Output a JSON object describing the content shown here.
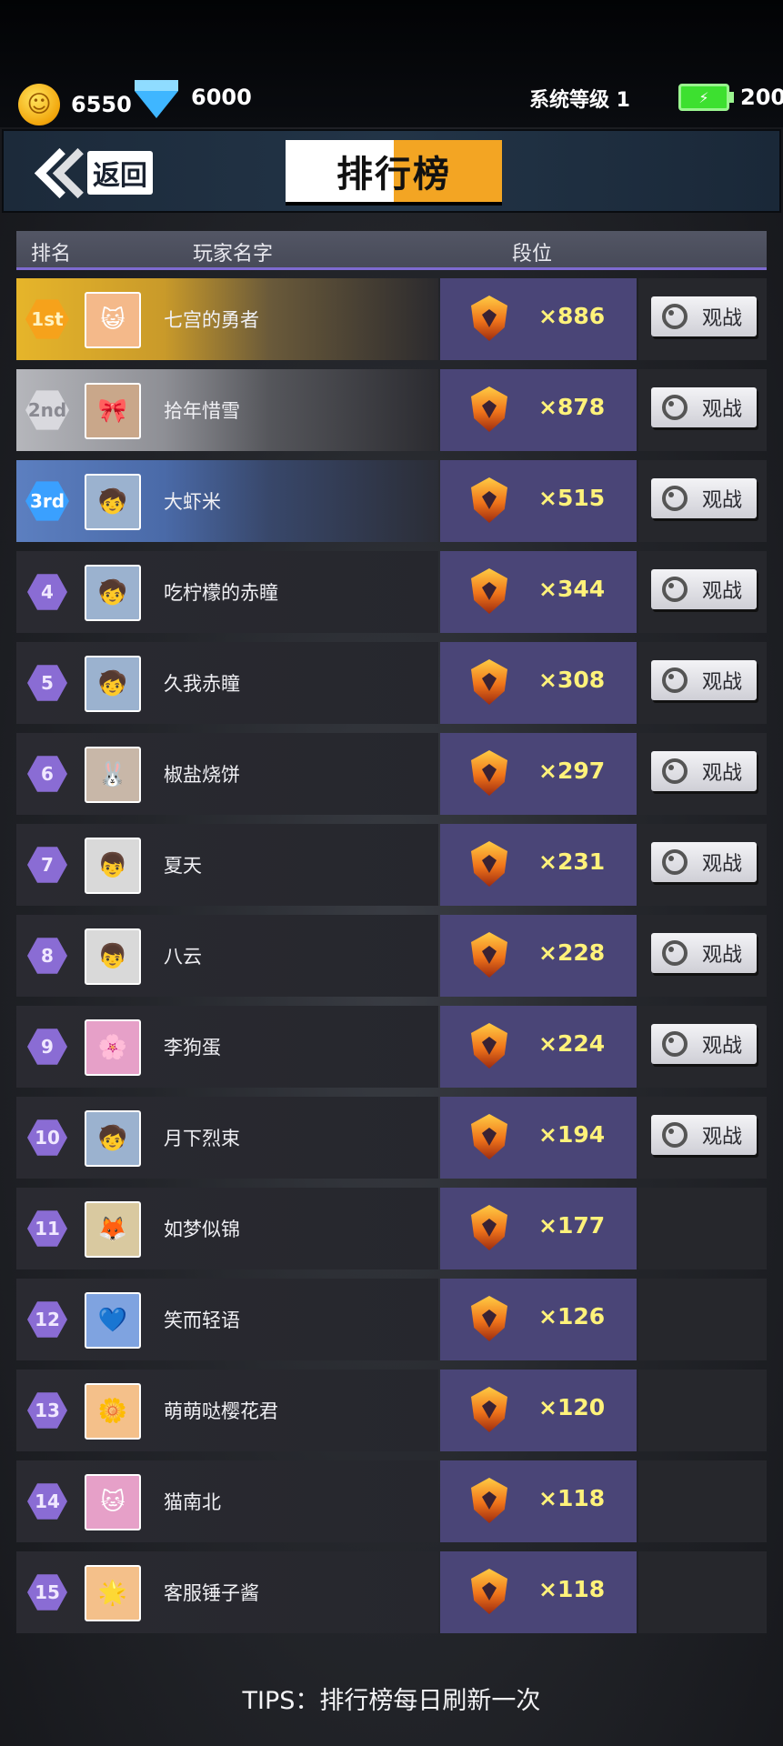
{
  "resources": {
    "coins": "6550",
    "gems": "6000",
    "system_level": "系统等级 1",
    "energy": "200"
  },
  "nav": {
    "back_label": "返回",
    "title": "排行榜"
  },
  "table_header": {
    "rank": "排名",
    "player_name": "玩家名字",
    "tier": "段位"
  },
  "watch_label": "观战",
  "rows": [
    {
      "rank": "1st",
      "name": "七宫的勇者",
      "score": "×886",
      "watch": true
    },
    {
      "rank": "2nd",
      "name": "拾年惜雪",
      "score": "×878",
      "watch": true
    },
    {
      "rank": "3rd",
      "name": "大虾米",
      "score": "×515",
      "watch": true
    },
    {
      "rank": "4",
      "name": "吃柠檬的赤瞳",
      "score": "×344",
      "watch": true
    },
    {
      "rank": "5",
      "name": "久我赤瞳",
      "score": "×308",
      "watch": true
    },
    {
      "rank": "6",
      "name": "椒盐烧饼",
      "score": "×297",
      "watch": true
    },
    {
      "rank": "7",
      "name": "夏天",
      "score": "×231",
      "watch": true
    },
    {
      "rank": "8",
      "name": "八云",
      "score": "×228",
      "watch": true
    },
    {
      "rank": "9",
      "name": "李狗蛋",
      "score": "×224",
      "watch": true
    },
    {
      "rank": "10",
      "name": "月下烈束",
      "score": "×194",
      "watch": true
    },
    {
      "rank": "11",
      "name": "如梦似锦",
      "score": "×177",
      "watch": false
    },
    {
      "rank": "12",
      "name": "笑而轻语",
      "score": "×126",
      "watch": false
    },
    {
      "rank": "13",
      "name": "萌萌哒樱花君",
      "score": "×120",
      "watch": false
    },
    {
      "rank": "14",
      "name": "猫南北",
      "score": "×118",
      "watch": false
    },
    {
      "rank": "15",
      "name": "客服锤子酱",
      "score": "×118",
      "watch": false
    }
  ],
  "tips": "TIPS：排行榜每日刷新一次"
}
